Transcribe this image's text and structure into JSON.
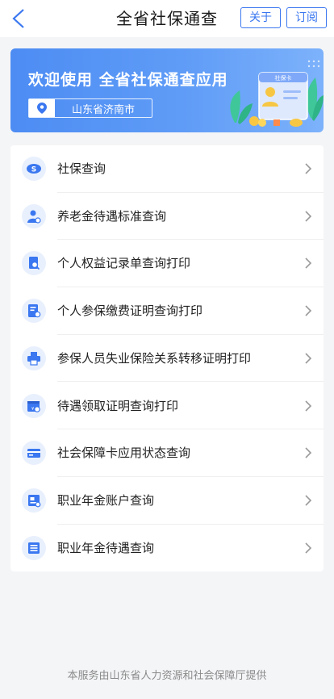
{
  "header": {
    "title": "全省社保通查",
    "about_label": "关于",
    "subscribe_label": "订阅"
  },
  "banner": {
    "title": "欢迎使用 全省社保通查应用",
    "location": "山东省济南市",
    "card_text": "社保卡"
  },
  "menu": {
    "items": [
      {
        "label": "社保查询",
        "icon": "social-security-icon"
      },
      {
        "label": "养老金待遇标准查询",
        "icon": "pension-person-icon"
      },
      {
        "label": "个人权益记录单查询打印",
        "icon": "record-search-icon"
      },
      {
        "label": "个人参保缴费证明查询打印",
        "icon": "payment-certificate-icon"
      },
      {
        "label": "参保人员失业保险关系转移证明打印",
        "icon": "printer-icon"
      },
      {
        "label": "待遇领取证明查询打印",
        "icon": "benefit-certificate-icon"
      },
      {
        "label": "社会保障卡应用状态查询",
        "icon": "card-icon"
      },
      {
        "label": "职业年金账户查询",
        "icon": "account-icon"
      },
      {
        "label": "职业年金待遇查询",
        "icon": "list-icon"
      }
    ]
  },
  "footer": {
    "text": "本服务由山东省人力资源和社会保障厅提供"
  },
  "colors": {
    "accent": "#3a77f0",
    "banner_start": "#4d8cf3",
    "banner_end": "#7db2fb",
    "icon_bg": "#e9f0fd",
    "page_bg": "#f4f5f7"
  }
}
